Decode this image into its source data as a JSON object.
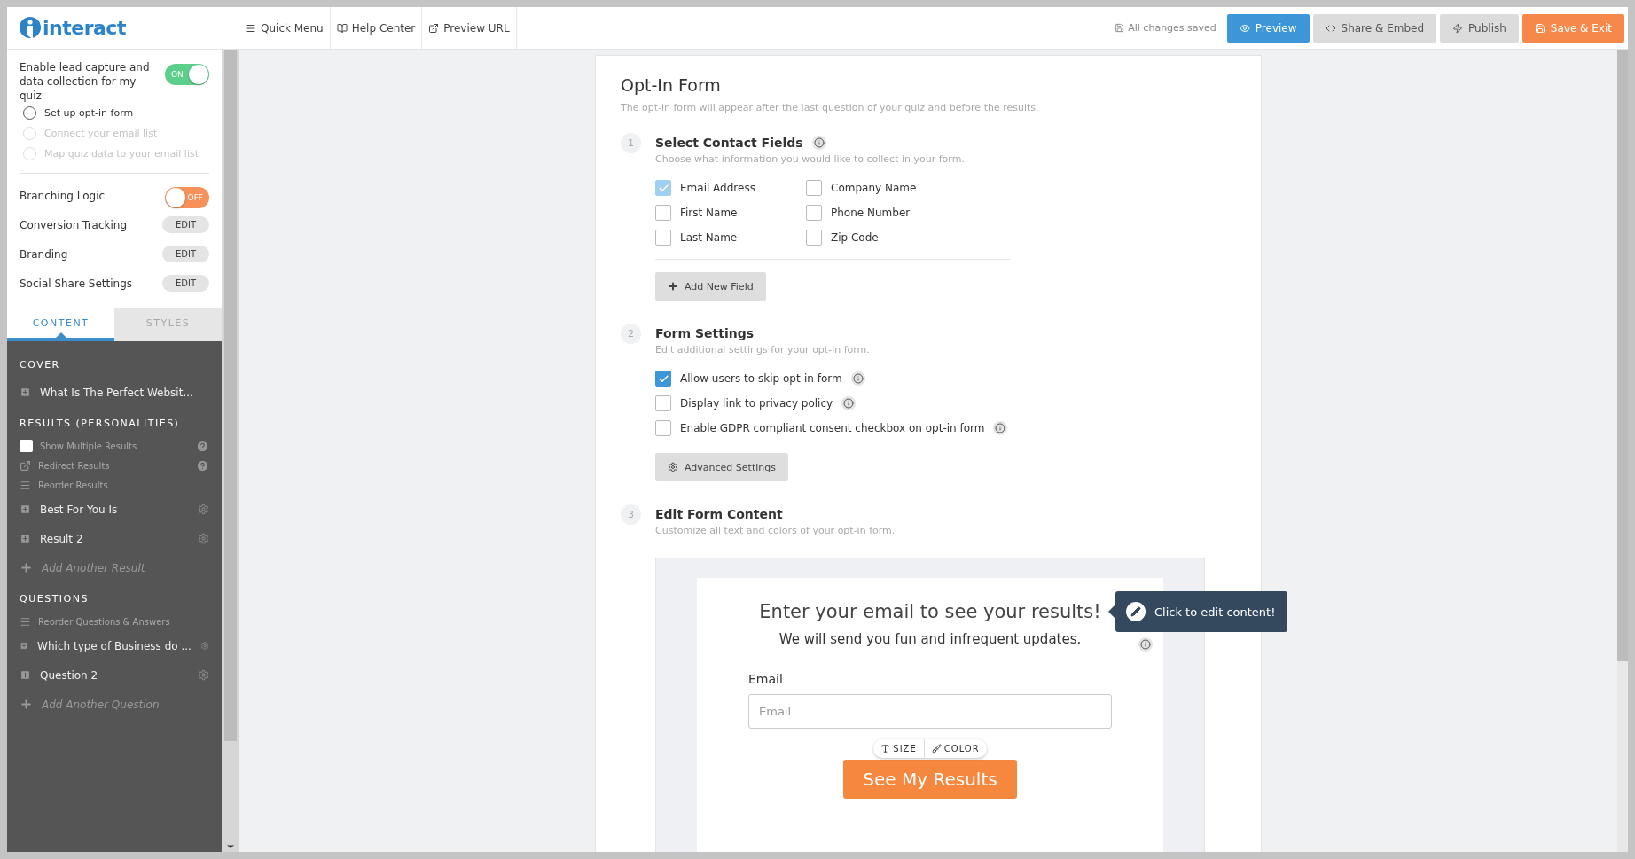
{
  "topbar": {
    "logo": "interact",
    "links": [
      {
        "label": "Quick Menu"
      },
      {
        "label": "Help Center"
      },
      {
        "label": "Preview URL"
      }
    ],
    "save_status": "All changes saved",
    "buttons": [
      {
        "label": "Preview",
        "kind": "primary"
      },
      {
        "label": "Share & Embed",
        "kind": "default"
      },
      {
        "label": "Publish",
        "kind": "default"
      },
      {
        "label": "Save & Exit",
        "kind": "accent"
      }
    ]
  },
  "sidebar": {
    "lead_capture": {
      "label": "Enable lead capture and data collection for my quiz",
      "on": true,
      "toggle_text": "ON",
      "steps": [
        {
          "label": "Set up opt-in form",
          "disabled": false
        },
        {
          "label": "Connect your email list",
          "disabled": true
        },
        {
          "label": "Map quiz data to your email list",
          "disabled": true
        }
      ]
    },
    "branching": {
      "label": "Branching Logic",
      "on": false,
      "toggle_text": "OFF"
    },
    "settings": [
      {
        "label": "Conversion Tracking",
        "button": "EDIT"
      },
      {
        "label": "Branding",
        "button": "EDIT"
      },
      {
        "label": "Social Share Settings",
        "button": "EDIT"
      }
    ],
    "tabs": [
      {
        "label": "CONTENT",
        "selected": true
      },
      {
        "label": "STYLES",
        "selected": false
      }
    ],
    "sections": [
      {
        "title": "COVER",
        "items": [
          {
            "label": "What Is The Perfect Websit...",
            "gear": false
          }
        ]
      },
      {
        "title": "RESULTS (PERSONALITIES)",
        "options": [
          {
            "kind": "checkbox",
            "label": "Show Multiple Results",
            "help": true,
            "checked": false
          },
          {
            "kind": "redirect",
            "label": "Redirect Results",
            "help": true
          },
          {
            "kind": "reorder",
            "label": "Reorder Results",
            "help": false
          }
        ],
        "items": [
          {
            "label": "Best For You Is",
            "gear": true
          },
          {
            "label": "Result 2",
            "gear": true
          }
        ],
        "add": "Add Another Result"
      },
      {
        "title": "QUESTIONS",
        "options": [
          {
            "kind": "reorder",
            "label": "Reorder Questions & Answers",
            "help": false
          }
        ],
        "items": [
          {
            "label": "Which type of Business do ...",
            "gear": true
          },
          {
            "label": "Question 2",
            "gear": true
          }
        ],
        "add": "Add Another Question"
      }
    ]
  },
  "form": {
    "title": "Opt-In Form",
    "subtitle": "The opt-in form will appear after the last question of your quiz and before the results.",
    "steps": [
      {
        "number": "1",
        "kind": "fields",
        "title": "Select Contact Fields",
        "info": true,
        "subtitle": "Choose what information you would like to collect in your form.",
        "options": [
          {
            "label": "Email Address",
            "checked": true,
            "disabled": true,
            "info": false
          },
          {
            "label": "First Name",
            "checked": false,
            "disabled": false,
            "info": false
          },
          {
            "label": "Last Name",
            "checked": false,
            "disabled": false,
            "info": false
          },
          {
            "label": "Company Name",
            "checked": false,
            "disabled": false,
            "info": false
          },
          {
            "label": "Phone Number",
            "checked": false,
            "disabled": false,
            "info": false
          },
          {
            "label": "Zip Code",
            "checked": false,
            "disabled": false,
            "info": false
          }
        ],
        "button": {
          "label": "Add New Field"
        }
      },
      {
        "number": "2",
        "kind": "settings",
        "title": "Form Settings",
        "info": false,
        "subtitle": "Edit additional settings for your opt-in form.",
        "options": [
          {
            "label": "Allow users to skip opt-in form",
            "checked": true,
            "disabled": false,
            "info": true
          },
          {
            "label": "Display link to privacy policy",
            "checked": false,
            "disabled": false,
            "info": true
          },
          {
            "label": "Enable GDPR compliant consent checkbox on opt-in form",
            "checked": false,
            "disabled": false,
            "info": true
          }
        ],
        "button": {
          "label": "Advanced Settings"
        }
      },
      {
        "number": "3",
        "kind": "preview",
        "title": "Edit Form Content",
        "info": false,
        "subtitle": "Customize all text and colors of your opt-in form.",
        "preview": {
          "headline": "Enter your email to see your results!",
          "tagline": "We will send you fun and infrequent updates.",
          "tooltip": "Click to edit content!",
          "field_label": "Email",
          "placeholder": "Email",
          "size_button": "SIZE",
          "color_button": "COLOR",
          "submit": "See My Results"
        }
      }
    ]
  }
}
